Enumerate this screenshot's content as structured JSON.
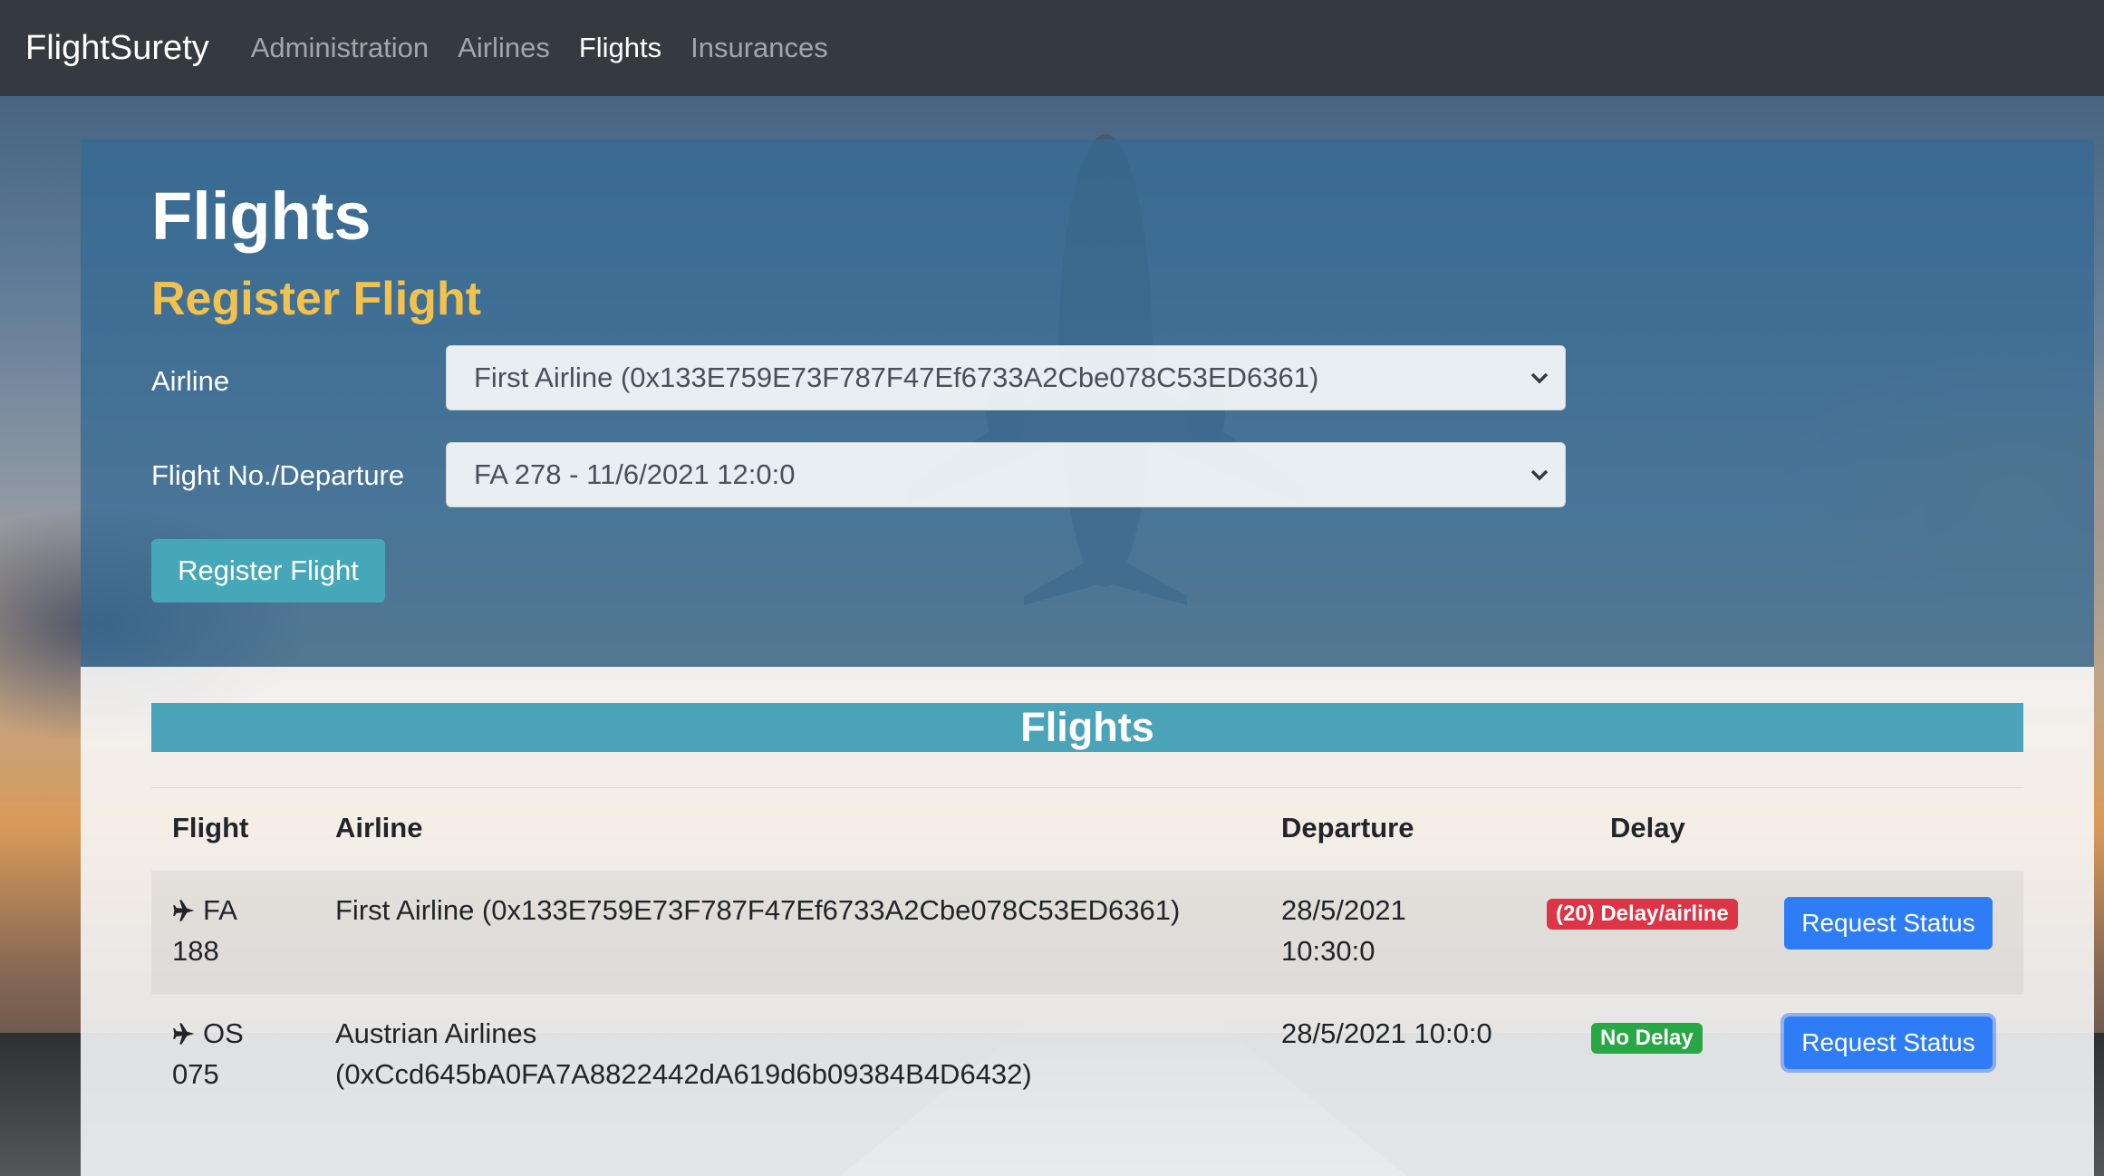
{
  "nav": {
    "brand": "FlightSurety",
    "links": [
      "Administration",
      "Airlines",
      "Flights",
      "Insurances"
    ],
    "active": "Flights"
  },
  "page": {
    "title": "Flights",
    "subtitle": "Register Flight"
  },
  "form": {
    "airline_label": "Airline",
    "airline_value": "First Airline (0x133E759E73F787F47Ef6733A2Cbe078C53ED6361)",
    "flight_label": "Flight No./Departure",
    "flight_value": "FA 278 - 11/6/2021 12:0:0",
    "submit_label": "Register Flight"
  },
  "flights_panel": {
    "header": "Flights",
    "columns": [
      "Flight",
      "Airline",
      "Departure",
      "Delay"
    ],
    "rows": [
      {
        "flight_line1": "FA",
        "flight_line2": "188",
        "airline": "First Airline (0x133E759E73F787F47Ef6733A2Cbe078C53ED6361)",
        "departure_line1": "28/5/2021",
        "departure_line2": "10:30:0",
        "delay": "(20) Delay/airline",
        "delay_status": "danger",
        "action": "Request Status"
      },
      {
        "flight_line1": "OS",
        "flight_line2": "075",
        "airline_line1": "Austrian Airlines",
        "airline_line2": "(0xCcd645bA0FA7A8822442dA619d6b09384B4D6432)",
        "departure": "28/5/2021 10:0:0",
        "delay": "No Delay",
        "delay_status": "success",
        "action": "Request Status"
      }
    ]
  },
  "colors": {
    "navbar": "#343a40",
    "accent_yellow": "#f2c14e",
    "info": "#46a7b8",
    "primary": "#2f7df6",
    "danger": "#dc3545",
    "success": "#28a745"
  },
  "icons": [
    "chevron-down-icon",
    "airplane-icon"
  ]
}
